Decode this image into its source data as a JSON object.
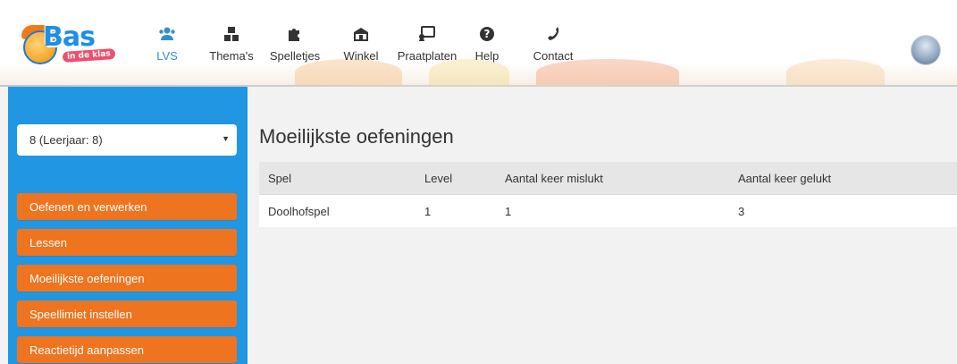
{
  "brand": {
    "name": "Bas",
    "tagline": "in de klas"
  },
  "nav": [
    {
      "id": "lvs",
      "label": "LVS",
      "icon": "users-icon",
      "active": true
    },
    {
      "id": "themas",
      "label": "Thema's",
      "icon": "blocks-icon",
      "active": false
    },
    {
      "id": "spelletjes",
      "label": "Spelletjes",
      "icon": "puzzle-icon",
      "active": false
    },
    {
      "id": "winkel",
      "label": "Winkel",
      "icon": "shop-icon",
      "active": false
    },
    {
      "id": "praatplaten",
      "label": "Praatplaten",
      "icon": "picture-icon",
      "active": false
    },
    {
      "id": "help",
      "label": "Help",
      "icon": "question-icon",
      "active": false
    },
    {
      "id": "contact",
      "label": "Contact",
      "icon": "phone-icon",
      "active": false
    }
  ],
  "sidebar": {
    "group_select": {
      "value": "8 (Leerjaar: 8)"
    },
    "items": [
      {
        "label": "Oefenen en verwerken"
      },
      {
        "label": "Lessen"
      },
      {
        "label": "Moeilijkste oefeningen"
      },
      {
        "label": "Speellimiet instellen"
      },
      {
        "label": "Reactietijd aanpassen"
      }
    ]
  },
  "main": {
    "title": "Moeilijkste oefeningen",
    "table": {
      "headers": [
        "Spel",
        "Level",
        "Aantal keer mislukt",
        "Aantal keer gelukt"
      ],
      "rows": [
        [
          "Doolhofspel",
          "1",
          "1",
          "3"
        ]
      ]
    }
  },
  "colors": {
    "accent_blue": "#2196e3",
    "nav_active": "#2f8fd8",
    "button_orange": "#ef7420"
  }
}
